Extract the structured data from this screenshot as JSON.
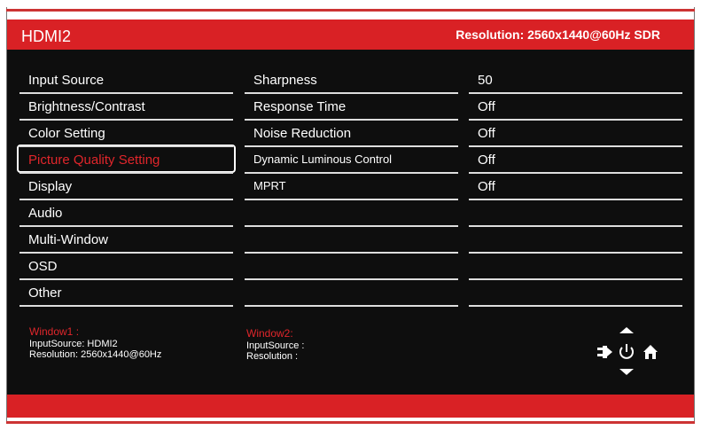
{
  "header": {
    "title": "HDMI2",
    "resolution": "Resolution: 2560x1440@60Hz SDR"
  },
  "menu": [
    "Input Source",
    "Brightness/Contrast",
    "Color Setting",
    "Picture Quality Setting",
    "Display",
    "Audio",
    "Multi-Window",
    "OSD",
    "Other"
  ],
  "selected_index": 3,
  "submenu": [
    "Sharpness",
    "Response Time",
    "Noise Reduction",
    "Dynamic Luminous Control",
    "MPRT",
    "",
    "",
    "",
    ""
  ],
  "values": [
    "50",
    "Off",
    "Off",
    "Off",
    "Off",
    "",
    "",
    "",
    ""
  ],
  "window1": {
    "label": "Window1 :",
    "input": "InputSource: HDMI2",
    "resolution": "Resolution: 2560x1440@60Hz"
  },
  "window2": {
    "label": "Window2:",
    "input": "InputSource :",
    "resolution": "Resolution :"
  },
  "colors": {
    "accent": "#d92125",
    "background": "#0e0e0e"
  }
}
